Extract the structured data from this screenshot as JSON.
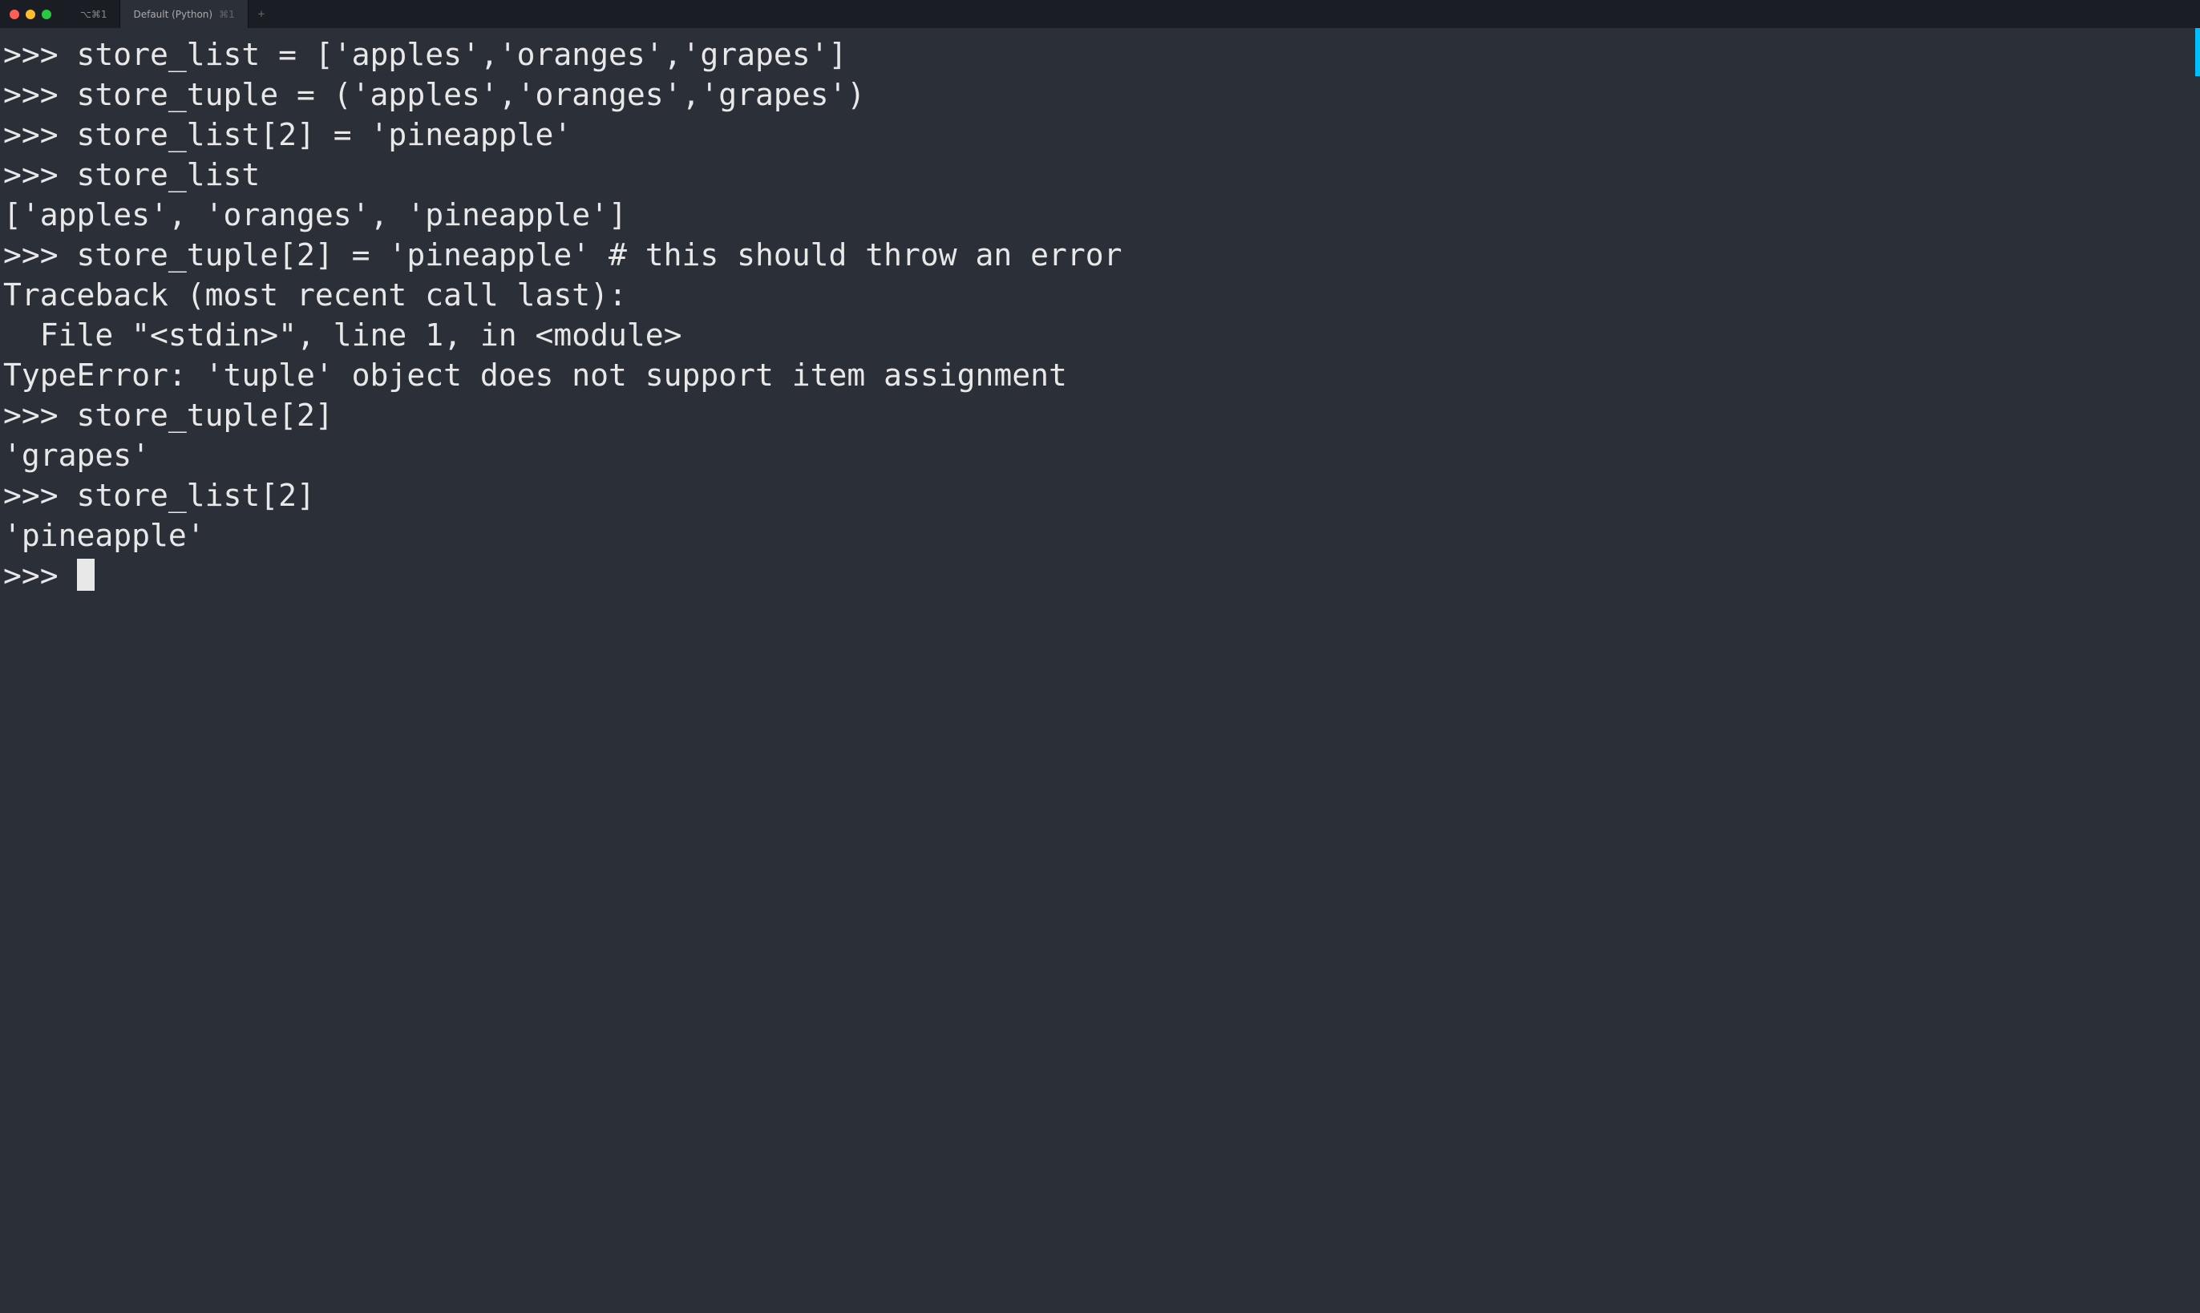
{
  "window": {
    "tabs": [
      {
        "label": "⌥⌘1",
        "shortcut": ""
      },
      {
        "label": "Default (Python)",
        "shortcut": "⌘1"
      }
    ],
    "newTabSymbol": "+"
  },
  "terminal": {
    "lines": [
      ">>> store_list = ['apples','oranges','grapes']",
      ">>> store_tuple = ('apples','oranges','grapes')",
      ">>> store_list[2] = 'pineapple'",
      ">>> store_list",
      "['apples', 'oranges', 'pineapple']",
      ">>> store_tuple[2] = 'pineapple' # this should throw an error",
      "Traceback (most recent call last):",
      "  File \"<stdin>\", line 1, in <module>",
      "TypeError: 'tuple' object does not support item assignment",
      ">>> store_tuple[2]",
      "'grapes'",
      ">>> store_list[2]",
      "'pineapple'",
      ">>> "
    ]
  }
}
